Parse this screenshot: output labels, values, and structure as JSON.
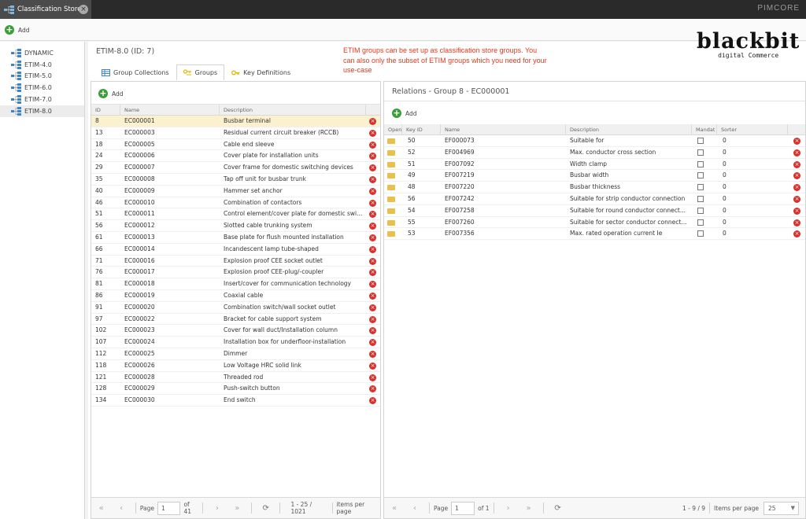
{
  "window": {
    "tab_title": "Classification Store",
    "brand": "PIMCORE"
  },
  "toolbar": {
    "add_label": "Add"
  },
  "tree": {
    "items": [
      {
        "label": "DYNAMIC",
        "selected": false
      },
      {
        "label": "ETIM-4.0",
        "selected": false
      },
      {
        "label": "ETIM-5.0",
        "selected": false
      },
      {
        "label": "ETIM-6.0",
        "selected": false
      },
      {
        "label": "ETIM-7.0",
        "selected": false
      },
      {
        "label": "ETIM-8.0",
        "selected": true
      }
    ]
  },
  "main": {
    "title": "ETIM-8.0 (ID: 7)",
    "note": "ETIM groups can be set up as classification store groups. You can also only the subset of ETIM groups which you need for your use-case",
    "logo": {
      "name": "blackbit",
      "tagline": "digital Commerce"
    },
    "tabs": [
      {
        "label": "Group Collections",
        "icon": "grid-icon",
        "active": false
      },
      {
        "label": "Groups",
        "icon": "key-group-icon",
        "active": true
      },
      {
        "label": "Key Definitions",
        "icon": "key-icon",
        "active": false
      }
    ]
  },
  "groups": {
    "add_label": "Add",
    "columns": [
      "ID",
      "Name",
      "Description"
    ],
    "rows": [
      {
        "id": "8",
        "name": "EC000001",
        "description": "Busbar terminal",
        "selected": true
      },
      {
        "id": "13",
        "name": "EC000003",
        "description": "Residual current circuit breaker (RCCB)"
      },
      {
        "id": "18",
        "name": "EC000005",
        "description": "Cable end sleeve"
      },
      {
        "id": "24",
        "name": "EC000006",
        "description": "Cover plate for installation units"
      },
      {
        "id": "29",
        "name": "EC000007",
        "description": "Cover frame for domestic switching devices"
      },
      {
        "id": "35",
        "name": "EC000008",
        "description": "Tap off unit for busbar trunk"
      },
      {
        "id": "40",
        "name": "EC000009",
        "description": "Hammer set anchor"
      },
      {
        "id": "46",
        "name": "EC000010",
        "description": "Combination of contactors"
      },
      {
        "id": "51",
        "name": "EC000011",
        "description": "Control element/cover plate for domestic swi..."
      },
      {
        "id": "56",
        "name": "EC000012",
        "description": "Slotted cable trunking system"
      },
      {
        "id": "61",
        "name": "EC000013",
        "description": "Base plate for flush mounted installation"
      },
      {
        "id": "66",
        "name": "EC000014",
        "description": "Incandescent lamp tube-shaped"
      },
      {
        "id": "71",
        "name": "EC000016",
        "description": "Explosion proof CEE socket outlet"
      },
      {
        "id": "76",
        "name": "EC000017",
        "description": "Explosion proof CEE-plug/-coupler"
      },
      {
        "id": "81",
        "name": "EC000018",
        "description": "Insert/cover for communication technology"
      },
      {
        "id": "86",
        "name": "EC000019",
        "description": "Coaxial cable"
      },
      {
        "id": "91",
        "name": "EC000020",
        "description": "Combination switch/wall socket outlet"
      },
      {
        "id": "97",
        "name": "EC000022",
        "description": "Bracket for cable support system"
      },
      {
        "id": "102",
        "name": "EC000023",
        "description": "Cover for wall duct/Installation column"
      },
      {
        "id": "107",
        "name": "EC000024",
        "description": "Installation box for underfloor-installation"
      },
      {
        "id": "112",
        "name": "EC000025",
        "description": "Dimmer"
      },
      {
        "id": "118",
        "name": "EC000026",
        "description": "Low Voltage HRC solid link"
      },
      {
        "id": "121",
        "name": "EC000028",
        "description": "Threaded rod"
      },
      {
        "id": "128",
        "name": "EC000029",
        "description": "Push-switch button"
      },
      {
        "id": "134",
        "name": "EC000030",
        "description": "End switch"
      }
    ],
    "pager": {
      "page_label": "Page",
      "page": "1",
      "of": "of 41",
      "summary": "1 - 25 / 1021",
      "items_label": "items per page"
    }
  },
  "relations": {
    "title": "Relations - Group 8 - EC000001",
    "add_label": "Add",
    "columns": [
      "Open",
      "Key ID",
      "Name",
      "Description",
      "Mandat",
      "Sorter"
    ],
    "rows": [
      {
        "key_id": "50",
        "name": "EF000073",
        "description": "Suitable for",
        "sorter": "0"
      },
      {
        "key_id": "52",
        "name": "EF004969",
        "description": "Max. conductor cross section",
        "sorter": "0"
      },
      {
        "key_id": "51",
        "name": "EF007092",
        "description": "Width clamp",
        "sorter": "0"
      },
      {
        "key_id": "49",
        "name": "EF007219",
        "description": "Busbar width",
        "sorter": "0"
      },
      {
        "key_id": "48",
        "name": "EF007220",
        "description": "Busbar thickness",
        "sorter": "0"
      },
      {
        "key_id": "56",
        "name": "EF007242",
        "description": "Suitable for strip conductor connection",
        "sorter": "0"
      },
      {
        "key_id": "54",
        "name": "EF007258",
        "description": "Suitable for round conductor connect...",
        "sorter": "0"
      },
      {
        "key_id": "55",
        "name": "EF007260",
        "description": "Suitable for sector conductor connect...",
        "sorter": "0"
      },
      {
        "key_id": "53",
        "name": "EF007356",
        "description": "Max. rated operation current Ie",
        "sorter": "0"
      }
    ],
    "pager": {
      "page_label": "Page",
      "page": "1",
      "of": "of 1",
      "summary": "1 - 9 / 9",
      "items_label": "Items per page",
      "items_value": "25"
    }
  }
}
